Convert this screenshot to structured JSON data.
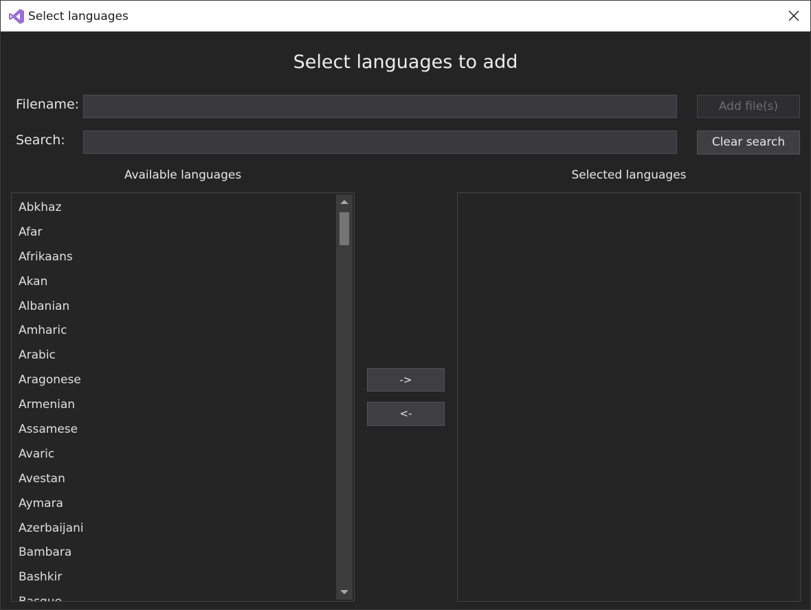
{
  "window": {
    "title": "Select languages",
    "accent": "#9b6bd6"
  },
  "heading": "Select languages to add",
  "filename": {
    "label": "Filename:",
    "value": "",
    "button": "Add file(s)"
  },
  "search": {
    "label": "Search:",
    "value": "",
    "button": "Clear search"
  },
  "available": {
    "label": "Available languages",
    "items": [
      "Abkhaz",
      "Afar",
      "Afrikaans",
      "Akan",
      "Albanian",
      "Amharic",
      "Arabic",
      "Aragonese",
      "Armenian",
      "Assamese",
      "Avaric",
      "Avestan",
      "Aymara",
      "Azerbaijani",
      "Bambara",
      "Bashkir",
      "Basque"
    ]
  },
  "selected": {
    "label": "Selected languages",
    "items": []
  },
  "transfer": {
    "add_label": "->",
    "remove_label": "<-"
  },
  "icons": {
    "app": "visual-studio-icon",
    "close": "close-icon",
    "scroll_up": "scroll-up-arrow-icon",
    "scroll_down": "scroll-down-arrow-icon"
  }
}
